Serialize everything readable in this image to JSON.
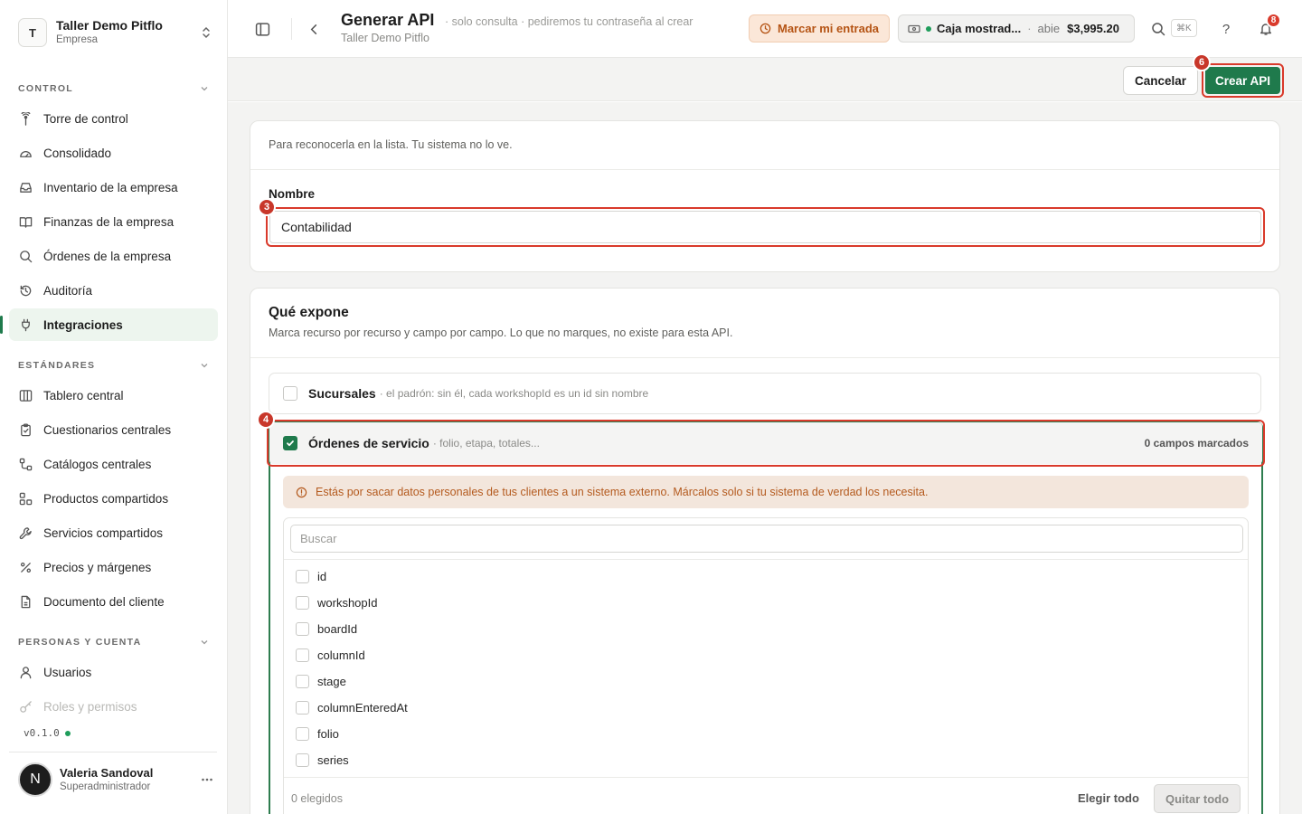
{
  "org": {
    "initial": "T",
    "name": "Taller Demo Pitflo",
    "type": "Empresa"
  },
  "sidebar": {
    "sections": [
      {
        "title": "CONTROL"
      },
      {
        "title": "ESTÁNDARES"
      },
      {
        "title": "PERSONAS Y CUENTA"
      }
    ],
    "items": [
      {
        "label": "Torre de control",
        "icon": "tower-icon"
      },
      {
        "label": "Consolidado",
        "icon": "gauge-icon"
      },
      {
        "label": "Inventario de la empresa",
        "icon": "inbox-icon"
      },
      {
        "label": "Finanzas de la empresa",
        "icon": "book-icon"
      },
      {
        "label": "Órdenes de la empresa",
        "icon": "search-icon"
      },
      {
        "label": "Auditoría",
        "icon": "history-icon"
      },
      {
        "label": "Integraciones",
        "icon": "plug-icon",
        "active": true
      },
      {
        "label": "Tablero central",
        "icon": "columns-icon"
      },
      {
        "label": "Cuestionarios centrales",
        "icon": "clipboard-icon"
      },
      {
        "label": "Catálogos centrales",
        "icon": "catalog-icon"
      },
      {
        "label": "Productos compartidos",
        "icon": "boxes-icon"
      },
      {
        "label": "Servicios compartidos",
        "icon": "wrench-icon"
      },
      {
        "label": "Precios y márgenes",
        "icon": "percent-icon"
      },
      {
        "label": "Documento del cliente",
        "icon": "document-icon"
      },
      {
        "label": "Usuarios",
        "icon": "user-icon"
      },
      {
        "label": "Roles y permisos",
        "icon": "key-icon"
      }
    ],
    "version": "v0.1.0"
  },
  "user": {
    "initial": "N",
    "name": "Valeria Sandoval",
    "role": "Superadministrador"
  },
  "topbar": {
    "title": "Generar API",
    "title_hint": "· solo consulta · pediremos tu contraseña al crear",
    "subtitle": "Taller Demo Pitflo",
    "mark_entry": "Marcar mi entrada",
    "till": {
      "name": "Caja mostrad...",
      "sep": "·",
      "state": "abie",
      "amount": "$3,995.20"
    },
    "shortcut": "⌘K",
    "help": "?",
    "notifications": "8"
  },
  "actions": {
    "cancel": "Cancelar",
    "create": "Crear API"
  },
  "steps": {
    "create": "6",
    "name": "3",
    "orders": "4"
  },
  "name_card": {
    "hint": "Para reconocerla en la lista. Tu sistema no lo ve.",
    "label": "Nombre",
    "value": "Contabilidad"
  },
  "expose_card": {
    "title": "Qué expone",
    "description": "Marca recurso por recurso y campo por campo. Lo que no marques, no existe para esta API.",
    "resources": [
      {
        "name": "Sucursales",
        "hint": "· el padrón: sin él, cada workshopId es un id sin nombre",
        "checked": false
      },
      {
        "name": "Órdenes de servicio",
        "hint": "· folio, etapa, totales...",
        "checked": true,
        "count": "0 campos marcados"
      }
    ],
    "warning": "Estás por sacar datos personales de tus clientes a un sistema externo. Márcalos solo si tu sistema de verdad los necesita.",
    "search_placeholder": "Buscar",
    "fields": [
      "id",
      "workshopId",
      "boardId",
      "columnId",
      "stage",
      "columnEnteredAt",
      "folio",
      "series"
    ],
    "picked": "0 elegidos",
    "select_all": "Elegir todo",
    "clear_all": "Quitar todo"
  },
  "colors": {
    "accent": "#1f7a4c",
    "highlight": "#d93a2b",
    "warning_bg": "#f3e6dc",
    "warning_text": "#b45a1e"
  }
}
